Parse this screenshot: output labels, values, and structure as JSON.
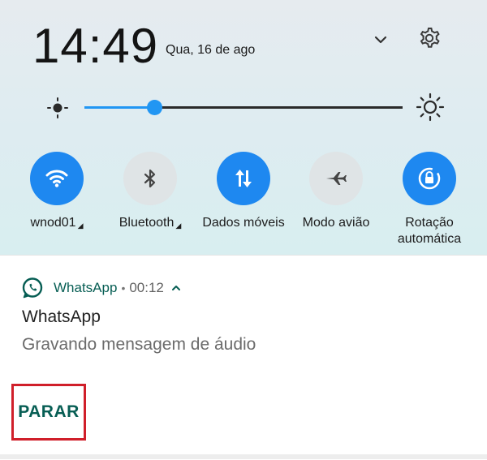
{
  "status": {
    "time": "14:49",
    "date": "Qua, 16 de ago",
    "expand_icon": "chevron-down-icon",
    "settings_icon": "gear-icon"
  },
  "brightness": {
    "level_fraction": 0.22,
    "low_icon": "brightness-low-icon",
    "high_icon": "brightness-high-icon",
    "accent_color": "#2196f3"
  },
  "quick_settings": {
    "tiles": [
      {
        "id": "wifi",
        "label": "wnod01",
        "has_menu": true,
        "active": true,
        "icon": "wifi-icon"
      },
      {
        "id": "bluetooth",
        "label": "Bluetooth",
        "has_menu": true,
        "active": false,
        "icon": "bluetooth-icon"
      },
      {
        "id": "data",
        "label": "Dados móveis",
        "has_menu": false,
        "active": true,
        "icon": "mobile-data-icon"
      },
      {
        "id": "airplane",
        "label": "Modo avião",
        "has_menu": false,
        "active": false,
        "icon": "airplane-icon"
      },
      {
        "id": "rotation",
        "label": "Rotação automática",
        "label_line1": "Rotação",
        "label_line2": "automática",
        "has_menu": false,
        "active": true,
        "icon": "auto-rotate-icon"
      }
    ],
    "active_color": "#1e88f0"
  },
  "notification": {
    "app_name": "WhatsApp",
    "separator": "•",
    "time": "00:12",
    "title": "WhatsApp",
    "text": "Gravando mensagem de áudio",
    "action_label": "PARAR",
    "app_color": "#075e54",
    "highlight_color": "#d01f2a"
  }
}
